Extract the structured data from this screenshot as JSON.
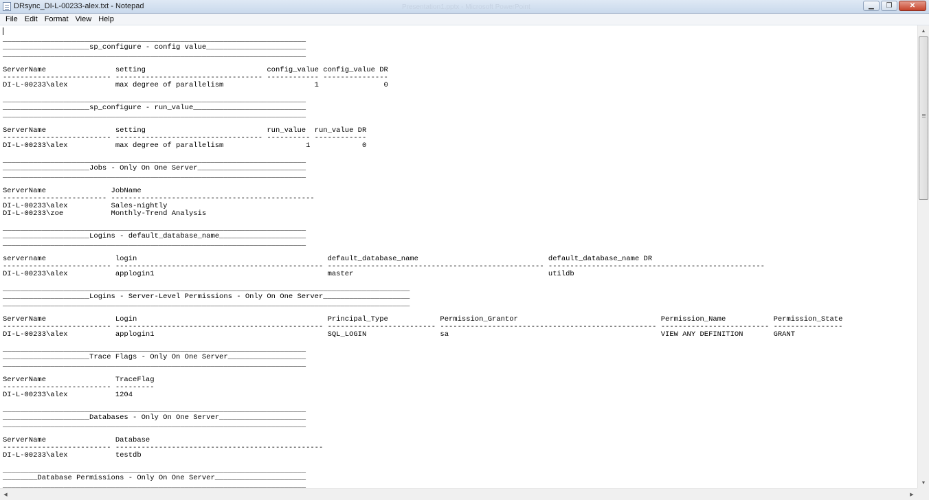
{
  "window": {
    "title": "DRsync_DI-L-00233-alex.txt - Notepad",
    "background_title": "Presentation1.pptx - Microsoft PowerPoint",
    "minimize_glyph": "▁",
    "restore_glyph": "❐",
    "close_glyph": "✕"
  },
  "menu": {
    "file": "File",
    "edit": "Edit",
    "format": "Format",
    "view": "View",
    "help": "Help"
  },
  "scrollbar": {
    "up": "▲",
    "down": "▼",
    "left": "◀",
    "right": "▶"
  },
  "document": {
    "text": "\n______________________________________________________________________\n____________________sp_configure - config value_______________________\n______________________________________________________________________\n\nServerName                setting                            config_value config_value DR\n------------------------- ---------------------------------- ------------ ---------------\nDI-L-00233\\alex           max degree of parallelism                     1               0\n\n______________________________________________________________________\n____________________sp_configure - run_value__________________________\n______________________________________________________________________\n\nServerName                setting                            run_value  run_value DR\n------------------------- ---------------------------------- ---------- ------------\nDI-L-00233\\alex           max degree of parallelism                   1            0\n\n______________________________________________________________________\n____________________Jobs - Only On One Server_________________________\n______________________________________________________________________\n\nServerName               JobName\n------------------------ -----------------------------------------------\nDI-L-00233\\alex          Sales-nightly\nDI-L-00233\\zoe           Monthly-Trend Analysis\n\n______________________________________________________________________\n____________________Logins - default_database_name____________________\n______________________________________________________________________\n\nservername                login                                            default_database_name                              default_database_name DR\n------------------------- ------------------------------------------------ -------------------------------------------------- --------------------------------------------------\nDI-L-00233\\alex           applogin1                                        master                                             utildb\n\n______________________________________________________________________________________________\n____________________Logins - Server-Level Permissions - Only On One Server____________________\n______________________________________________________________________________________________\n\nServerName                Login                                            Principal_Type            Permission_Grantor                                 Permission_Name           Permission_State\n------------------------- ------------------------------------------------ ------------------------- -------------------------------------------------- ------------------------- ----------------\nDI-L-00233\\alex           applogin1                                        SQL_LOGIN                 sa                                                 VIEW ANY DEFINITION       GRANT\n\n______________________________________________________________________\n____________________Trace Flags - Only On One Server__________________\n______________________________________________________________________\n\nServerName                TraceFlag\n------------------------- ---------\nDI-L-00233\\alex           1204\n\n______________________________________________________________________\n____________________Databases - Only On One Server____________________\n______________________________________________________________________\n\nServerName                Database\n------------------------- ------------------------------------------------\nDI-L-00233\\alex           testdb\n\n______________________________________________________________________\n________Database Permissions - Only On One Server_____________________\n______________________________________________________________________"
  }
}
